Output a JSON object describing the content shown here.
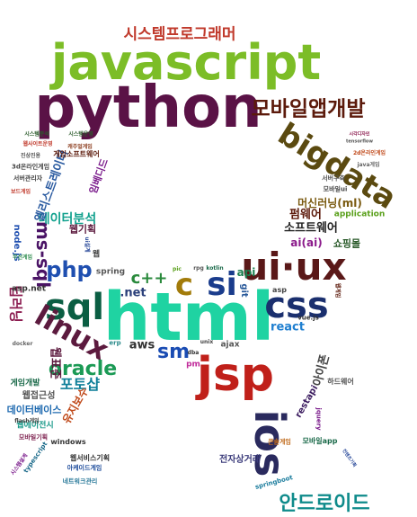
{
  "words": [
    {
      "text": "시스템프로그래머",
      "color": "#c0392b"
    },
    {
      "text": "javascript",
      "color": "#7cbd27"
    },
    {
      "text": "python",
      "color": "#5a1246"
    },
    {
      "text": "모바일앱개발",
      "color": "#5c1a0b"
    },
    {
      "text": "bigdata",
      "color": "#5b4a10"
    },
    {
      "text": "ui·ux",
      "color": "#5a1818"
    },
    {
      "text": "html",
      "color": "#1fd3a2"
    },
    {
      "text": "sql",
      "color": "#0b5e43"
    },
    {
      "text": "jsp",
      "color": "#c0201a"
    },
    {
      "text": "css",
      "color": "#1a2f6e"
    },
    {
      "text": "안드로이드",
      "color": "#0f8b8b"
    },
    {
      "text": "ios",
      "color": "#2a2a5e"
    },
    {
      "text": "linux",
      "color": "#5c1a3e"
    },
    {
      "text": "oracle",
      "color": "#1b9a55"
    },
    {
      "text": "php",
      "color": "#1f4fb0"
    },
    {
      "text": "si",
      "color": "#1a3c8c"
    },
    {
      "text": "c",
      "color": "#a27b0a"
    },
    {
      "text": "sm",
      "color": "#1a4cb3"
    },
    {
      "text": "c++",
      "color": "#2a8a3c"
    },
    {
      "text": "ms-sql",
      "color": "#4b1466"
    },
    {
      "text": "데이터분석",
      "color": "#12a18e"
    },
    {
      "text": "포토샵",
      "color": "#0f7f99"
    },
    {
      "text": "웹표준",
      "color": "#5c1a3e"
    },
    {
      "text": "딥러닝",
      "color": "#8b1b4f"
    },
    {
      "text": "엘리스트레이터",
      "color": "#2a5aa0"
    },
    {
      "text": "임베디드",
      "color": "#7a1b8b"
    },
    {
      "text": "아이폰",
      "color": "#444"
    },
    {
      "text": "펌웨어",
      "color": "#5c1a0b"
    },
    {
      "text": "소프트웨어",
      "color": "#222"
    },
    {
      "text": "머신러닝(ml)",
      "color": "#7a5a10"
    },
    {
      "text": "ai(ai)",
      "color": "#8b1b8b"
    },
    {
      "text": "쇼핑몰",
      "color": "#2a5a2a"
    },
    {
      "text": "application",
      "color": "#5aa01b"
    },
    {
      "text": "restapi",
      "color": "#3a1a5e"
    },
    {
      "text": "react",
      "color": "#1f7fd0"
    },
    {
      "text": "aws",
      "color": "#333"
    },
    {
      "text": ".net",
      "color": "#2a3f7a"
    },
    {
      "text": "api",
      "color": "#1b7f4f"
    },
    {
      "text": "git",
      "color": "#2a5a9a"
    },
    {
      "text": "spring",
      "color": "#555"
    },
    {
      "text": "ajax",
      "color": "#555"
    },
    {
      "text": "pm",
      "color": "#c02a9a"
    },
    {
      "text": "erp",
      "color": "#2a8a8a"
    },
    {
      "text": "웹기획",
      "color": "#5c1a3e"
    },
    {
      "text": "게임개발",
      "color": "#1b6a4a"
    },
    {
      "text": "웹접근성",
      "color": "#555"
    },
    {
      "text": "데이터베이스",
      "color": "#1f6ab0"
    },
    {
      "text": "웹에이전시",
      "color": "#1b9a8a"
    },
    {
      "text": "유지보수",
      "color": "#c04a1b"
    },
    {
      "text": "전자상거래",
      "color": "#3a3a7a"
    },
    {
      "text": "node.js",
      "color": "#1f4fb0"
    },
    {
      "text": "asp.net",
      "color": "#333"
    },
    {
      "text": "asp",
      "color": "#444"
    },
    {
      "text": "vue.js",
      "color": "#333"
    },
    {
      "text": "하드웨어",
      "color": "#555"
    },
    {
      "text": "jquery",
      "color": "#7a1b8b"
    },
    {
      "text": "windows",
      "color": "#333"
    },
    {
      "text": "typescript",
      "color": "#1b6a8a"
    },
    {
      "text": "springboot",
      "color": "#1f7f9f"
    },
    {
      "text": "콘솔게임",
      "color": "#c06a1b"
    },
    {
      "text": "모바일app",
      "color": "#1b6a4a"
    },
    {
      "text": "웹서비스기획",
      "color": "#333"
    },
    {
      "text": "아케이드게임",
      "color": "#1b4a9a"
    },
    {
      "text": "네트워크관리",
      "color": "#2a7a9a"
    },
    {
      "text": "모바일기획",
      "color": "#7a1b4a"
    },
    {
      "text": "시스템분석",
      "color": "#2a5a2a"
    },
    {
      "text": "시스템운영",
      "color": "#2a5a2a"
    },
    {
      "text": "웹사이트운영",
      "color": "#c0392b"
    },
    {
      "text": "캐주얼게임",
      "color": "#8b3a1b"
    },
    {
      "text": "진상진용",
      "color": "#555"
    },
    {
      "text": "게임소프트웨어",
      "color": "#5c1a0b"
    },
    {
      "text": "3d온라인게임",
      "color": "#444"
    },
    {
      "text": "서버관리자",
      "color": "#444"
    },
    {
      "text": "보드게임",
      "color": "#c0392b"
    },
    {
      "text": "웹",
      "color": "#444"
    },
    {
      "text": "ui설계",
      "color": "#2a4a9a"
    },
    {
      "text": "무선게임",
      "color": "#2a8a4a"
    },
    {
      "text": "docker",
      "color": "#666"
    },
    {
      "text": "flash게임",
      "color": "#444"
    },
    {
      "text": "시스템설계",
      "color": "#7a1b8b"
    },
    {
      "text": "2d온라인게임",
      "color": "#c04a1b"
    },
    {
      "text": "java게임",
      "color": "#666"
    },
    {
      "text": "서버구축",
      "color": "#555"
    },
    {
      "text": "모바일ui",
      "color": "#444"
    },
    {
      "text": "tensorflow",
      "color": "#555"
    },
    {
      "text": "시각디자인",
      "color": "#8b1b4f"
    },
    {
      "text": "pic",
      "color": "#5aa01b"
    },
    {
      "text": "rpg",
      "color": "#555"
    },
    {
      "text": "kotlin",
      "color": "#1b6a4a"
    },
    {
      "text": "dba",
      "color": "#333"
    },
    {
      "text": "unix",
      "color": "#444"
    },
    {
      "text": "웹게임",
      "color": "#5c1a0b"
    },
    {
      "text": "컨텐츠기획",
      "color": "#2a4a9a"
    }
  ]
}
